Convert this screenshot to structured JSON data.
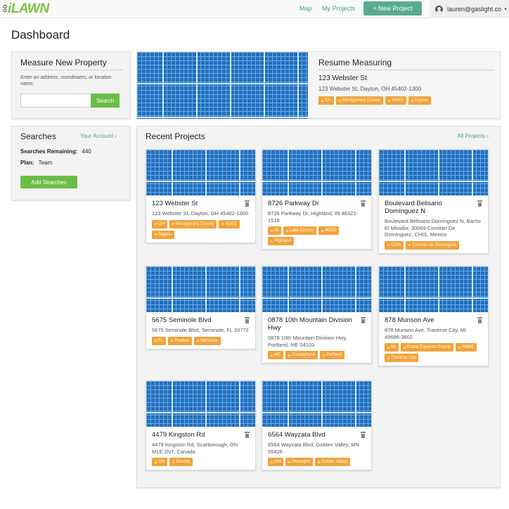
{
  "nav": {
    "logo_prefix": "GO",
    "logo": "iLAWN",
    "map_link": "Map",
    "projects_link": "My Projects",
    "new_project": "+ New Project",
    "user_email": "lauren@gaslight.co",
    "user_icon": "user-circle-icon",
    "caret": "▾"
  },
  "page": {
    "title": "Dashboard"
  },
  "measure": {
    "title": "Measure New Property",
    "instructions": "Enter an address, coordinates, or location name.",
    "search_value": "",
    "search_button": "Search"
  },
  "searches": {
    "title": "Searches",
    "account_link": "Your Account  ›",
    "remaining_label": "Searches Remaining:",
    "remaining_value": "440",
    "plan_label": "Plan:",
    "plan_value": "Team",
    "add_button": "Add Searches"
  },
  "resume": {
    "title": "Resume Measuring",
    "name": "123 Webster St",
    "address": "123 Webster St, Dayton, OH 45402-1300",
    "tags": [
      "OH",
      "Montgomery County",
      "45402",
      "Dayton"
    ]
  },
  "recent": {
    "title": "Recent Projects",
    "all_link": "All Projects  ›",
    "projects": [
      {
        "name": "123 Webster St",
        "address": "123 Webster St, Dayton, OH 45402-1300",
        "tags": [
          "OH",
          "Montgomery County",
          "45402",
          "Dayton"
        ]
      },
      {
        "name": "8726 Parkway Dr",
        "address": "8726 Parkway Dr, Highland, IN 46322-1518",
        "tags": [
          "IN",
          "Lake County",
          "46322",
          "Highland"
        ]
      },
      {
        "name": "Boulevard Belisario Domínguez N",
        "address": "Boulevard Belisario Domínguez N, Barrio El Mirador, 30069 Comitán De Domínguez, CHIS, Mexico",
        "tags": [
          "CHIS",
          "Comitán de Domínguez"
        ]
      },
      {
        "name": "5675 Seminole Blvd",
        "address": "5675 Seminole Blvd, Seminole, FL 33772",
        "tags": [
          "FL",
          "Pinellas",
          "Seminole"
        ]
      },
      {
        "name": "0878 10th Mountain Division Hwy",
        "address": "0878 10th Mountain Division Hwy, Portland, ME 04103",
        "tags": [
          "ME",
          "Cumberland",
          "Portland"
        ]
      },
      {
        "name": "878 Munson Ave",
        "address": "878 Munson Ave, Traverse City, MI 49686-3602",
        "tags": [
          "MI",
          "Grand Traverse County",
          "49686",
          "Traverse City"
        ]
      },
      {
        "name": "4479 Kingston Rd",
        "address": "4479 Kingston Rd, Scarborough, ON M1E 2N7, Canada",
        "tags": [
          "ON",
          "Toronto"
        ]
      },
      {
        "name": "6564 Wayzata Blvd",
        "address": "6564 Wayzata Blvd, Golden Valley, MN 55426",
        "tags": [
          "MN",
          "Hennepin",
          "Golden Valley"
        ]
      }
    ]
  },
  "colors": {
    "accent": "#5aaa91",
    "green": "#6cbd45",
    "tag": "#f2a33a",
    "map_blue": "#1f6fc0"
  }
}
